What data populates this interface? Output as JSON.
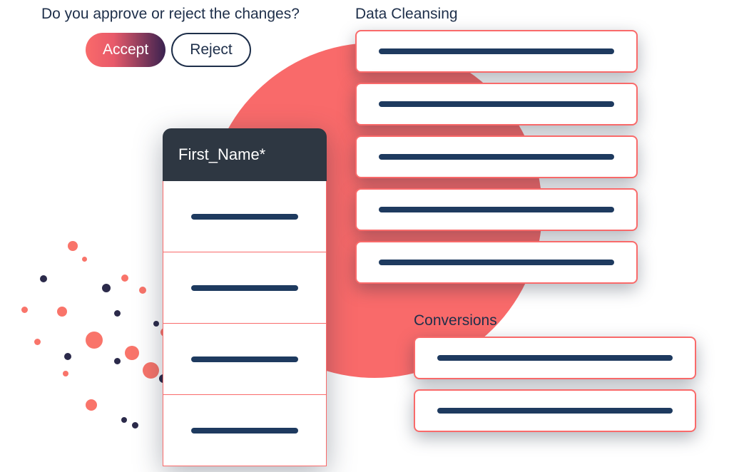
{
  "prompt": "Do you approve or reject the changes?",
  "buttons": {
    "accept": "Accept",
    "reject": "Reject"
  },
  "sections": {
    "data_cleansing": {
      "label": "Data Cleansing",
      "rows": 5
    },
    "conversions": {
      "label": "Conversions",
      "rows": 2
    }
  },
  "column": {
    "header": "First_Name*",
    "cells": 4
  },
  "colors": {
    "accent": "#f96a6a",
    "navy": "#1e3a5f",
    "dark": "#2e3742",
    "text": "#1e2f4a"
  }
}
